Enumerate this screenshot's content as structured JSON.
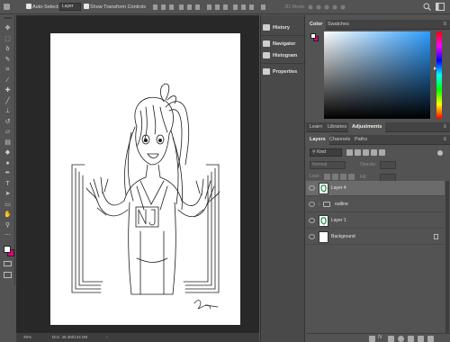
{
  "options_bar": {
    "auto_select_label": "Auto-Select:",
    "auto_select_target": "Layer",
    "transform_controls_label": "Show Transform Controls",
    "mode_3d_label": "3D Mode:"
  },
  "toolbar": {
    "tools": [
      {
        "icon": "move-icon",
        "glyph": "✥"
      },
      {
        "icon": "marquee-icon",
        "glyph": "⬚"
      },
      {
        "icon": "lasso-icon",
        "glyph": "ꝺ"
      },
      {
        "icon": "quick-select-icon",
        "glyph": "✎"
      },
      {
        "icon": "crop-icon",
        "glyph": "⌗"
      },
      {
        "icon": "eyedropper-icon",
        "glyph": "⁄"
      },
      {
        "icon": "healing-brush-icon",
        "glyph": "✚"
      },
      {
        "icon": "brush-icon",
        "glyph": "╱"
      },
      {
        "icon": "clone-stamp-icon",
        "glyph": "⊥"
      },
      {
        "icon": "history-brush-icon",
        "glyph": "↺"
      },
      {
        "icon": "eraser-icon",
        "glyph": "▱"
      },
      {
        "icon": "gradient-icon",
        "glyph": "▤"
      },
      {
        "icon": "blur-icon",
        "glyph": "◆"
      },
      {
        "icon": "dodge-icon",
        "glyph": "●"
      },
      {
        "icon": "pen-icon",
        "glyph": "✒"
      },
      {
        "icon": "type-icon",
        "glyph": "T"
      },
      {
        "icon": "path-select-icon",
        "glyph": "➤"
      },
      {
        "icon": "shape-icon",
        "glyph": "▭"
      },
      {
        "icon": "hand-icon",
        "glyph": "✋"
      },
      {
        "icon": "zoom-icon",
        "glyph": "⚲"
      },
      {
        "icon": "more-tools-icon",
        "glyph": "⋯"
      }
    ],
    "foreground_color": "#ffffff",
    "background_color": "#e0007a"
  },
  "status": {
    "zoom": "25%",
    "doc_size": "Doc: 48.2M/144.0M"
  },
  "panel_strip": {
    "items": [
      "History",
      "Navigator",
      "Histogram",
      "Properties"
    ]
  },
  "color_panel": {
    "tabs": [
      "Color",
      "Swatches"
    ],
    "active_tab": "Color",
    "picker_hue_color": "#2d9cff"
  },
  "adjustments_panel": {
    "tabs": [
      "Learn",
      "Libraries",
      "Adjustments"
    ],
    "active_tab": "Adjustments"
  },
  "layers_panel": {
    "tabs": [
      "Layers",
      "Channels",
      "Paths"
    ],
    "active_tab": "Layers",
    "filter_label": "Kind",
    "blend_mode": "Normal",
    "opacity_label": "Opacity:",
    "lock_label": "Lock:",
    "fill_label": "Fill:",
    "layers": [
      {
        "name": "Layer 4",
        "selected": true,
        "type": "drawing"
      },
      {
        "name": "outline",
        "selected": false,
        "type": "group"
      },
      {
        "name": "Layer 1",
        "selected": false,
        "type": "drawing"
      },
      {
        "name": "Background",
        "selected": false,
        "type": "background"
      }
    ]
  }
}
